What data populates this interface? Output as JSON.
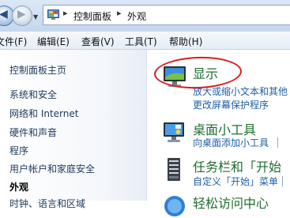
{
  "address_bar": {
    "breadcrumbs": [
      "控制面板",
      "外观"
    ],
    "back_icon": "back-arrow-icon",
    "forward_icon": "forward-arrow-icon"
  },
  "menu_bar": {
    "items": [
      "文件(F)",
      "编辑(E)",
      "查看(V)",
      "工具(T)",
      "帮助(H)"
    ]
  },
  "left_nav": {
    "home": "控制面板主页",
    "items": [
      "系统和安全",
      "网络和 Internet",
      "硬件和声音",
      "程序",
      "用户帐户和家庭安全"
    ],
    "current": "外观",
    "partial_item": "时钟、语言和区域"
  },
  "categories": [
    {
      "title": "显示",
      "icon": "display-icon",
      "links": [
        "放大或缩小文本和其他",
        "更改屏幕保护程序"
      ]
    },
    {
      "title": "桌面小工具",
      "icon": "desktop-gadgets-icon",
      "links": [
        "向桌面添加小工具"
      ]
    },
    {
      "title": "任务栏和「开始",
      "icon": "taskbar-icon",
      "links": [
        "自定义「开始」菜单"
      ]
    },
    {
      "title": "轻松访问中心",
      "icon": "ease-of-access-icon",
      "links": []
    }
  ],
  "colors": {
    "category_title": "#1e6d2e",
    "link": "#1f5fa6",
    "highlight_circle": "#d81e1e"
  }
}
